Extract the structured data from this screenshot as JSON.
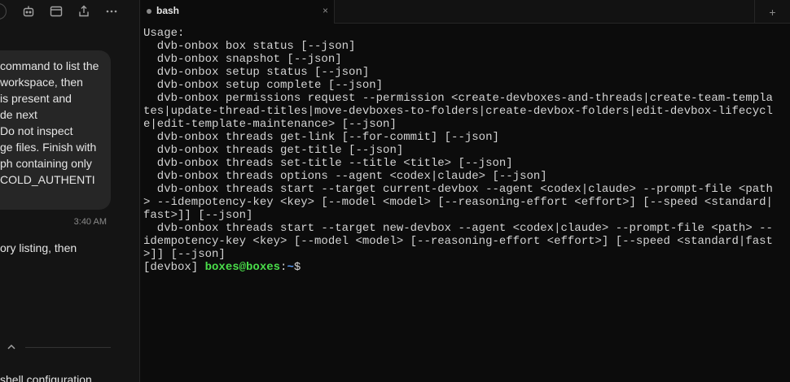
{
  "toolbar": {
    "icons": [
      "circle-button",
      "bot-icon",
      "browser-window-icon",
      "share-icon",
      "more-icon"
    ]
  },
  "chat": {
    "user_message_lines": [
      "command to list the",
      "workspace, then",
      "is present and",
      "de next",
      "Do not inspect",
      "ge files. Finish with",
      "ph containing only",
      "COLD_AUTHENTI"
    ],
    "timestamp": "3:40 AM",
    "assistant_text": "ory listing, then",
    "bottom_text": "shell configuration"
  },
  "terminal": {
    "tab": {
      "title": "bash",
      "close": "×"
    },
    "new_tab": "+",
    "lines": [
      "Usage:",
      "  dvb-onbox box status [--json]",
      "  dvb-onbox snapshot [--json]",
      "  dvb-onbox setup status [--json]",
      "  dvb-onbox setup complete [--json]",
      "  dvb-onbox permissions request --permission <create-devboxes-and-threads|create-team-templa",
      "tes|update-thread-titles|move-devboxes-to-folders|create-devbox-folders|edit-devbox-lifecycl",
      "e|edit-template-maintenance> [--json]",
      "  dvb-onbox threads get-link [--for-commit] [--json]",
      "  dvb-onbox threads get-title [--json]",
      "  dvb-onbox threads set-title --title <title> [--json]",
      "  dvb-onbox threads options --agent <codex|claude> [--json]",
      "  dvb-onbox threads start --target current-devbox --agent <codex|claude> --prompt-file <path",
      "> --idempotency-key <key> [--model <model> [--reasoning-effort <effort>] [--speed <standard|",
      "fast>]] [--json]",
      "  dvb-onbox threads start --target new-devbox --agent <codex|claude> --prompt-file <path> --",
      "idempotency-key <key> [--model <model> [--reasoning-effort <effort>] [--speed <standard|fast",
      ">]] [--json]"
    ],
    "prompt": {
      "prefix": "[devbox] ",
      "user": "boxes@boxes",
      "sep": ":",
      "path": "~",
      "symbol": "$"
    }
  },
  "colors": {
    "background": "#0c0c0c",
    "panel": "#141414",
    "bubble": "#262626",
    "prompt_user": "#4ade4a",
    "prompt_path": "#5b9cf6"
  }
}
